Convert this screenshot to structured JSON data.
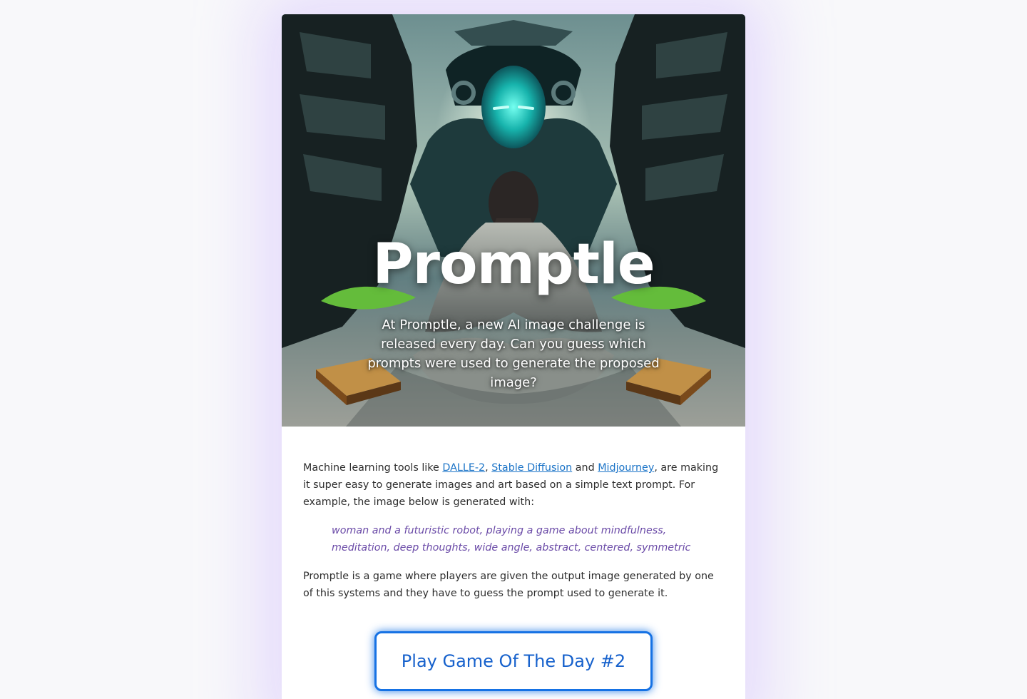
{
  "hero": {
    "title": "Promptle",
    "subtitle": "At Promptle, a new AI image challenge is released every day. Can you guess which prompts were used to generate the proposed image?"
  },
  "content": {
    "intro_before": "Machine learning tools like ",
    "links": [
      "DALLE-2",
      "Stable Diffusion",
      "Midjourney"
    ],
    "between_1": ", ",
    "between_2": " and ",
    "intro_after": ", are making it super easy to generate images and art based on a simple text prompt. For example, the image below is generated with:",
    "prompt": "woman and a futuristic robot, playing a game about mindfulness, meditation, deep thoughts, wide angle, abstract, centered, symmetric",
    "outro": "Promptle is a game where players are given the output image generated by one of this systems and they have to guess the prompt used to generate it."
  },
  "cta": {
    "label": "Play Game Of The Day #2"
  },
  "colors": {
    "background": "#f8f8fa",
    "card": "#ffffff",
    "link": "#1a73c7",
    "quote": "#6a4aa7",
    "button": "#1672e4"
  }
}
